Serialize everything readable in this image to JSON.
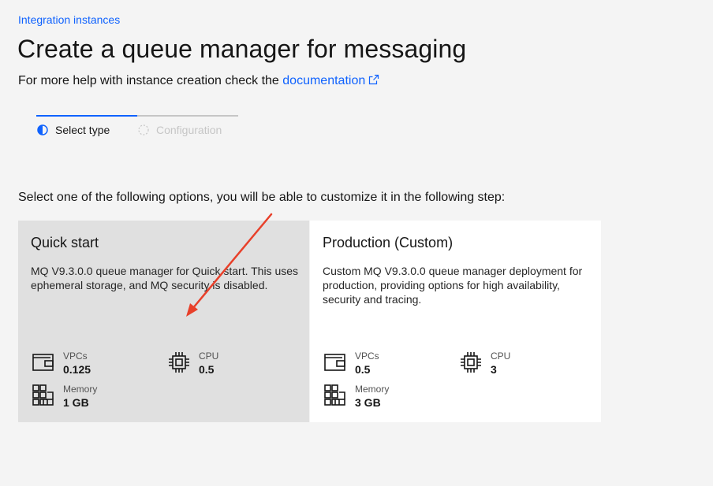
{
  "breadcrumb": {
    "label": "Integration instances"
  },
  "page": {
    "title": "Create a queue manager for messaging",
    "help_text": "For more help with instance creation check the ",
    "help_link": "documentation"
  },
  "progress": {
    "steps": [
      {
        "label": "Select type",
        "state": "current"
      },
      {
        "label": "Configuration",
        "state": "incomplete"
      }
    ]
  },
  "instruction": "Select one of the following options, you will be able to customize it in the following step:",
  "tiles": [
    {
      "title": "Quick start",
      "description": "MQ V9.3.0.0 queue manager for Quick start. This uses ephemeral storage, and MQ security is disabled.",
      "state": "hovered",
      "specs": {
        "vpcs": {
          "label": "VPCs",
          "value": "0.125",
          "icon": "wallet-icon"
        },
        "cpu": {
          "label": "CPU",
          "value": "0.5",
          "icon": "chip-icon"
        },
        "memory": {
          "label": "Memory",
          "value": "1 GB",
          "icon": "memory-icon"
        }
      }
    },
    {
      "title": "Production (Custom)",
      "description": "Custom MQ V9.3.0.0 queue manager deployment for production, providing options for high availability, security and tracing.",
      "state": "default",
      "specs": {
        "vpcs": {
          "label": "VPCs",
          "value": "0.5",
          "icon": "wallet-icon"
        },
        "cpu": {
          "label": "CPU",
          "value": "3",
          "icon": "chip-icon"
        },
        "memory": {
          "label": "Memory",
          "value": "3 GB",
          "icon": "memory-icon"
        }
      }
    }
  ],
  "colors": {
    "link": "#0f62fe",
    "background": "#f4f4f4",
    "tile_hover": "#e0e0e0",
    "tile": "#ffffff",
    "annotation_arrow": "#e8402a"
  }
}
